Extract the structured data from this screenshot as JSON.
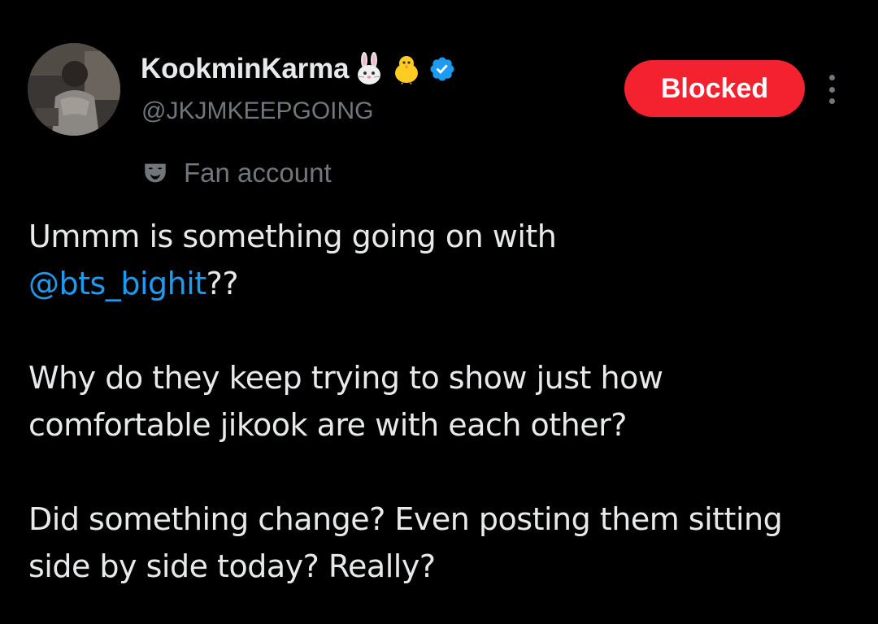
{
  "author": {
    "display_name": "KookminKarma",
    "emojis": [
      "🐰",
      "🐥"
    ],
    "handle": "@JKJMKEEPGOING",
    "verified": true,
    "label": "Fan account",
    "label_icon": "theater-masks-icon",
    "avatar_icon": "profile-photo"
  },
  "actions": {
    "blocked_label": "Blocked",
    "more_icon": "more-vertical-icon"
  },
  "tweet": {
    "line1_text": "Ummm is something going on with",
    "mention": "@bts_bighit",
    "line2_suffix": "??",
    "paragraph2": "Why do they keep trying to show just how comfortable jikook are with each other?",
    "paragraph3": "Did something change? Even posting them sitting side by side today? Really?"
  },
  "colors": {
    "background": "#000000",
    "text_primary": "#e7e9ea",
    "text_secondary": "#71767b",
    "accent_blue": "#1d9bf0",
    "blocked_red": "#f4212e"
  }
}
